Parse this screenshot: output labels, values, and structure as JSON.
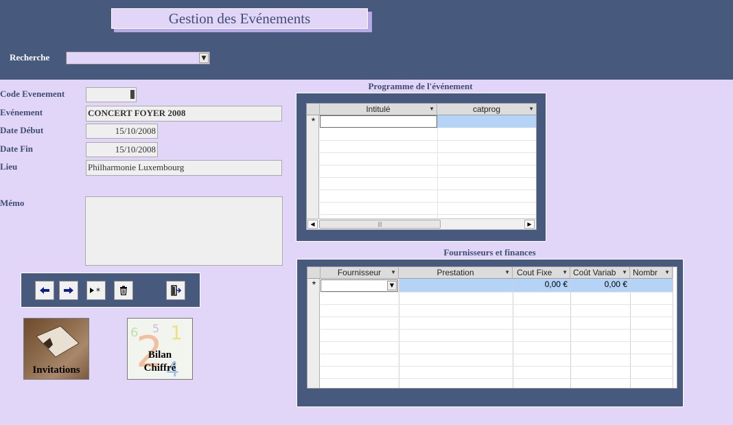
{
  "header": {
    "title": "Gestion des Evénements",
    "search_label": "Recherche",
    "search_value": ""
  },
  "form": {
    "code_label": "Code Evenement",
    "code_value": "",
    "event_label": "Evénement",
    "event_value": "CONCERT FOYER 2008",
    "start_label": "Date Début",
    "start_value": "15/10/2008",
    "end_label": "Date Fin",
    "end_value": "15/10/2008",
    "place_label": "Lieu",
    "place_value": "Philharmonie Luxembourg",
    "memo_label": "Mémo",
    "memo_value": ""
  },
  "buttons": {
    "invitations": "Invitations",
    "bilan_line1": "Bilan",
    "bilan_line2": "Chiffré"
  },
  "programme": {
    "title": "Programme de l'événement",
    "columns": [
      "Intitulé",
      "catprog"
    ],
    "new_row_marker": "*"
  },
  "fournisseurs": {
    "title": "Fournisseurs et finances",
    "columns": [
      "Fournisseur",
      "Prestation",
      "Cout Fixe",
      "Coût Variab",
      "Nombr"
    ],
    "new_row_marker": "*",
    "new_row": {
      "cout_fixe": "0,00 €",
      "cout_variable": "0,00 €"
    }
  },
  "colors": {
    "header_bg": "#475a7e",
    "page_bg": "#e1d6f8",
    "highlight": "#b4d3f7"
  }
}
